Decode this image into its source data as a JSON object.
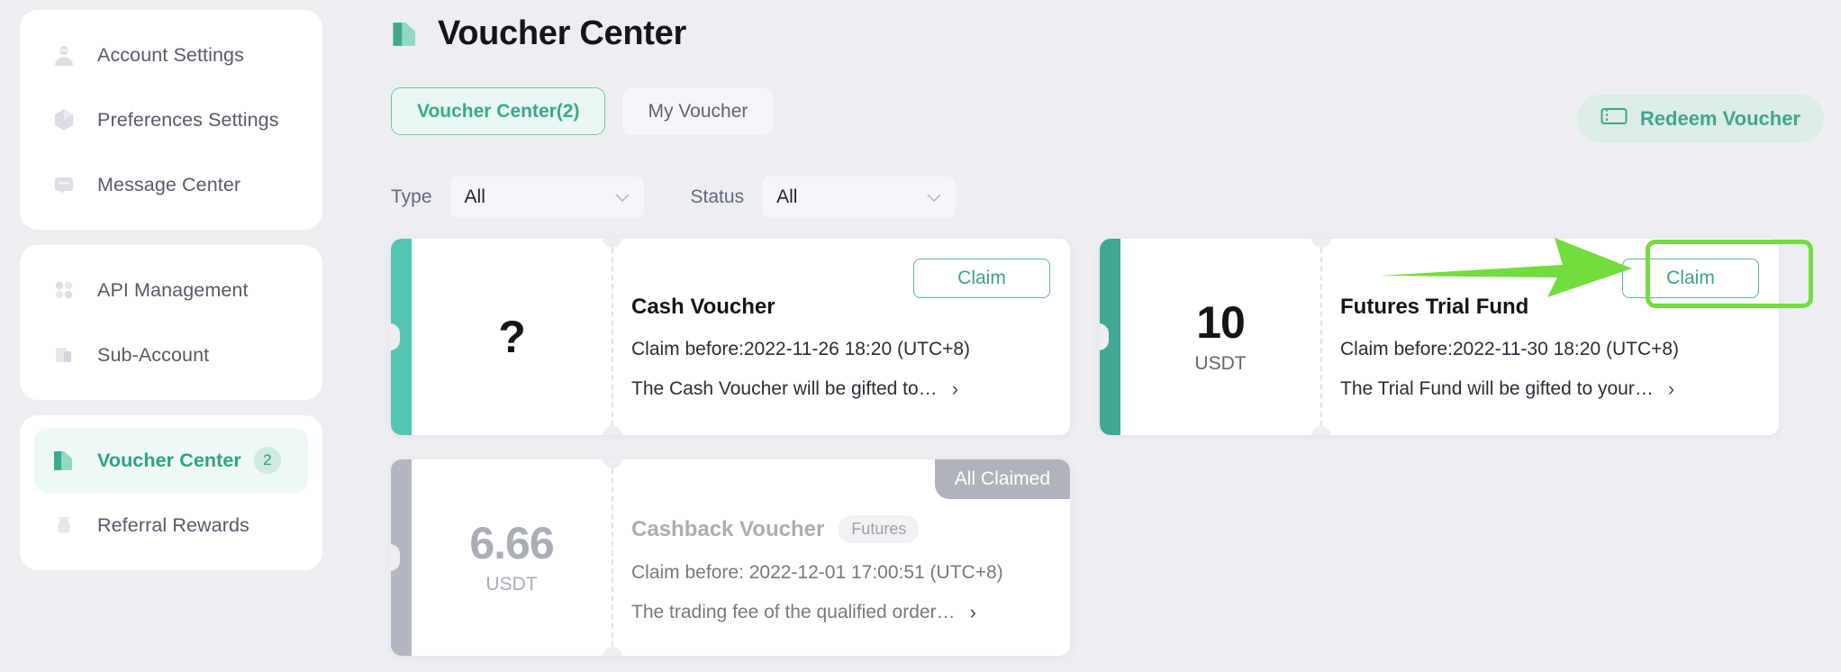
{
  "sidebar": {
    "groups": [
      {
        "items": [
          {
            "label": "Account Settings",
            "icon": "user-icon",
            "active": false
          },
          {
            "label": "Preferences Settings",
            "icon": "palette-icon",
            "active": false
          },
          {
            "label": "Message Center",
            "icon": "mail-icon",
            "active": false
          }
        ]
      },
      {
        "items": [
          {
            "label": "API Management",
            "icon": "grid-dots-icon",
            "active": false
          },
          {
            "label": "Sub-Account",
            "icon": "sub-account-icon",
            "active": false
          }
        ]
      },
      {
        "items": [
          {
            "label": "Voucher Center",
            "icon": "voucher-icon",
            "active": true,
            "badge": "2"
          },
          {
            "label": "Referral Rewards",
            "icon": "gift-bag-icon",
            "active": false
          }
        ]
      }
    ]
  },
  "header": {
    "title": "Voucher Center",
    "title_icon": "voucher-icon"
  },
  "tabs": [
    {
      "label": "Voucher Center(2)",
      "active": true
    },
    {
      "label": "My Voucher",
      "active": false
    }
  ],
  "redeem": {
    "label": "Redeem Voucher",
    "icon": "ticket-icon"
  },
  "filters": [
    {
      "label": "Type",
      "value": "All",
      "icon": "chevron-down-icon"
    },
    {
      "label": "Status",
      "value": "All",
      "icon": "chevron-down-icon"
    }
  ],
  "vouchers": [
    {
      "amount": "?",
      "unit": "",
      "name": "Cash Voucher",
      "tag": "",
      "claim_before": "Claim before:2022-11-26 18:20 (UTC+8)",
      "description": "The Cash Voucher will be gifted to…",
      "action_label": "Claim",
      "state": "claimable",
      "stub_color": "#53c5b1"
    },
    {
      "amount": "10",
      "unit": "USDT",
      "name": "Futures Trial Fund",
      "tag": "",
      "claim_before": "Claim before:2022-11-30 18:20 (UTC+8)",
      "description": "The Trial Fund will be gifted to your…",
      "action_label": "Claim",
      "state": "claimable",
      "stub_color": "#41a893"
    },
    {
      "amount": "6.66",
      "unit": "USDT",
      "name": "Cashback Voucher",
      "tag": "Futures",
      "claim_before": "Claim before: 2022-12-01 17:00:51 (UTC+8)",
      "description": "The trading fee of the qualified order…",
      "action_label": "All Claimed",
      "state": "claimed",
      "stub_color": "#b4b7bf"
    }
  ],
  "annotation": {
    "color": "#72dd3e",
    "target": "Claim"
  },
  "colors": {
    "accent": "#38a98d",
    "page_bg": "#edeef2",
    "highlight": "#72dd3e"
  }
}
